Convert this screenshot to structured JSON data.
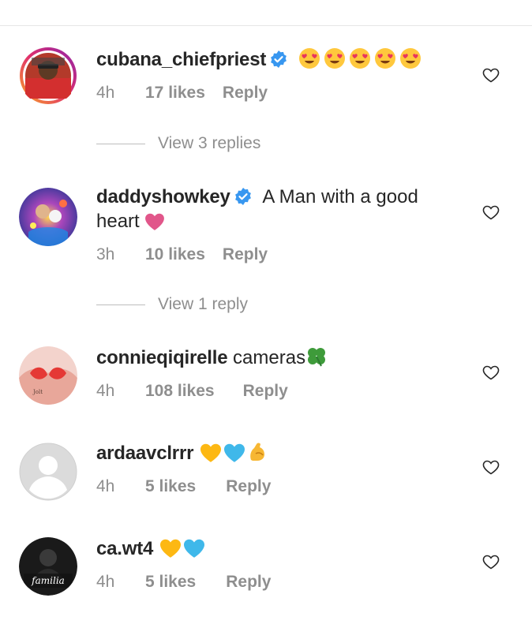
{
  "comments": [
    {
      "username": "cubana_chiefpriest",
      "verified": true,
      "text": "",
      "emojis": "heart-eyes-emoji x5",
      "time": "4h",
      "likes": "17 likes",
      "reply": "Reply"
    },
    {
      "username": "daddyshowkey",
      "verified": true,
      "text": "A Man with a good",
      "text2": "heart",
      "emojis": "pink-heart-emoji",
      "time": "3h",
      "likes": "10 likes",
      "reply": "Reply"
    },
    {
      "username": "connieqiqirelle",
      "verified": false,
      "text": "cameras",
      "emojis": "four-leaf-clover-emoji",
      "time": "4h",
      "likes": "108 likes",
      "reply": "Reply"
    },
    {
      "username": "ardaavclrrr",
      "verified": false,
      "text": "",
      "emojis": "yellow-heart, blue-heart, flexed-biceps",
      "time": "4h",
      "likes": "5 likes",
      "reply": "Reply"
    },
    {
      "username": "ca.wt4",
      "verified": false,
      "text": "",
      "emojis": "yellow-heart, blue-heart",
      "time": "4h",
      "likes": "5 likes",
      "reply": "Reply",
      "avatar_text": "familia"
    }
  ],
  "view_replies": [
    "View 3 replies",
    "View 1 reply"
  ],
  "colors": {
    "text": "#262626",
    "muted": "#8e8e8e",
    "verified_blue": "#3897f0",
    "heart_pink": "#e1568a",
    "yellow_heart": "#fdb813",
    "blue_heart": "#3fb8ea"
  }
}
